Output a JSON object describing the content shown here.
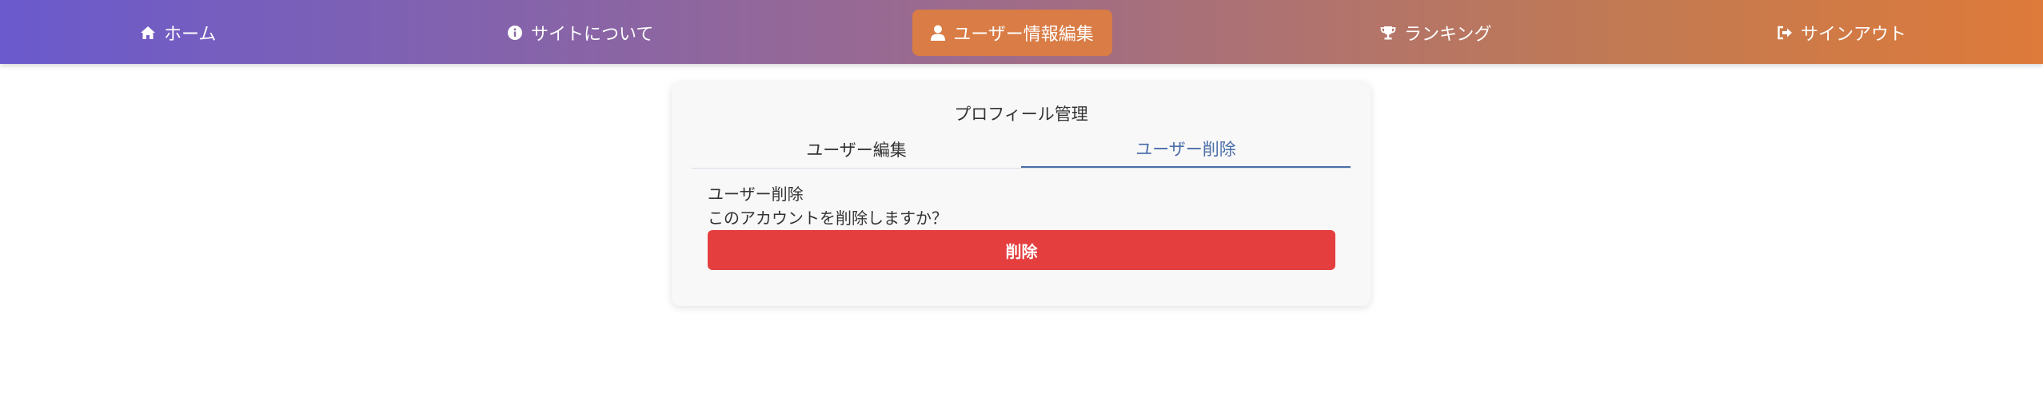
{
  "nav": {
    "home": {
      "label": "ホーム",
      "icon": "home-icon"
    },
    "about": {
      "label": "サイトについて",
      "icon": "info-icon"
    },
    "profile": {
      "label": "ユーザー情報編集",
      "icon": "user-icon"
    },
    "ranking": {
      "label": "ランキング",
      "icon": "trophy-icon"
    },
    "signout": {
      "label": "サインアウト",
      "icon": "sign-out-icon"
    }
  },
  "card": {
    "title": "プロフィール管理",
    "tabs": [
      {
        "label": "ユーザー編集"
      },
      {
        "label": "ユーザー削除"
      }
    ],
    "section_heading": "ユーザー削除",
    "question": "このアカウントを削除しますか？",
    "delete_label": "削除"
  },
  "colors": {
    "nav_gradient_start": "#6a5acd",
    "nav_gradient_end": "#de7a3a",
    "active_nav": "#d97c45",
    "active_tab": "#4a6ea8",
    "danger": "#e53e3e"
  }
}
